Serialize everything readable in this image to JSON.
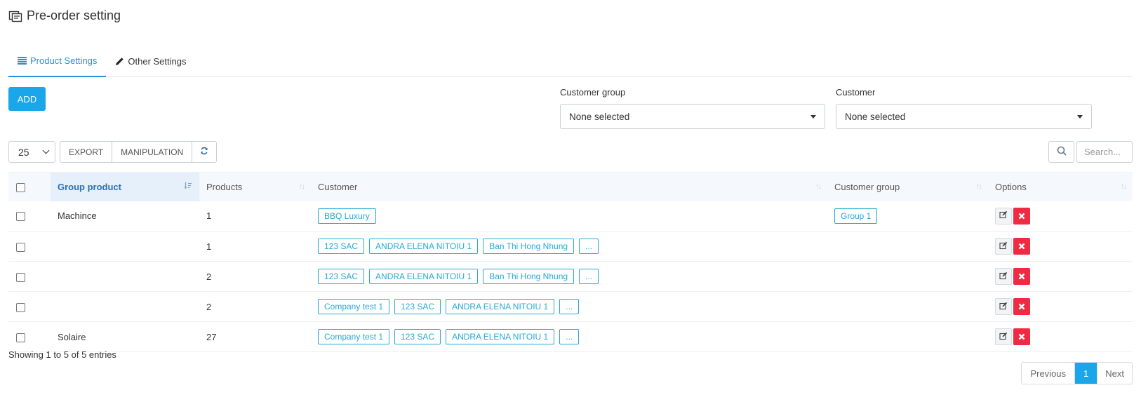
{
  "page": {
    "title": "Pre-order setting",
    "title_icon": "preorder-icon"
  },
  "tabs": [
    {
      "label": "Product Settings",
      "icon": "list-icon",
      "active": true
    },
    {
      "label": "Other Settings",
      "icon": "pencil-icon",
      "active": false
    }
  ],
  "add_button": "ADD",
  "filters": {
    "customer_group": {
      "label": "Customer group",
      "value": "None selected"
    },
    "customer": {
      "label": "Customer",
      "value": "None selected"
    }
  },
  "toolbar": {
    "page_length": "25",
    "export_label": "EXPORT",
    "manipulation_label": "MANIPULATION",
    "refresh_icon": "refresh-icon"
  },
  "search": {
    "placeholder": "Search...",
    "icon": "search-icon"
  },
  "table": {
    "columns": [
      "Group product",
      "Products",
      "Customer",
      "Customer group",
      "Options"
    ],
    "rows": [
      {
        "group_product": "Machince",
        "products": "1",
        "customers": [
          "BBQ Luxury"
        ],
        "customer_groups": [
          "Group 1"
        ]
      },
      {
        "group_product": "",
        "products": "1",
        "customers": [
          "123 SAC",
          "ANDRA ELENA NITOIU 1",
          "Ban Thi Hong Nhung",
          "..."
        ],
        "customer_groups": []
      },
      {
        "group_product": "",
        "products": "2",
        "customers": [
          "123 SAC",
          "ANDRA ELENA NITOIU 1",
          "Ban Thi Hong Nhung",
          "..."
        ],
        "customer_groups": []
      },
      {
        "group_product": "",
        "products": "2",
        "customers": [
          "Company test 1",
          "123 SAC",
          "ANDRA ELENA NITOIU 1",
          "..."
        ],
        "customer_groups": []
      },
      {
        "group_product": "Solaire",
        "products": "27",
        "customers": [
          "Company test 1",
          "123 SAC",
          "ANDRA ELENA NITOIU 1",
          "..."
        ],
        "customer_groups": []
      }
    ]
  },
  "info": "Showing 1 to 5 of 5 entries",
  "pagination": {
    "previous": "Previous",
    "current": "1",
    "next": "Next"
  },
  "colors": {
    "accent": "#1aa6ea",
    "tab_active": "#2e8fd1",
    "tag": "#27a9d6",
    "delete": "#ee2b42"
  }
}
